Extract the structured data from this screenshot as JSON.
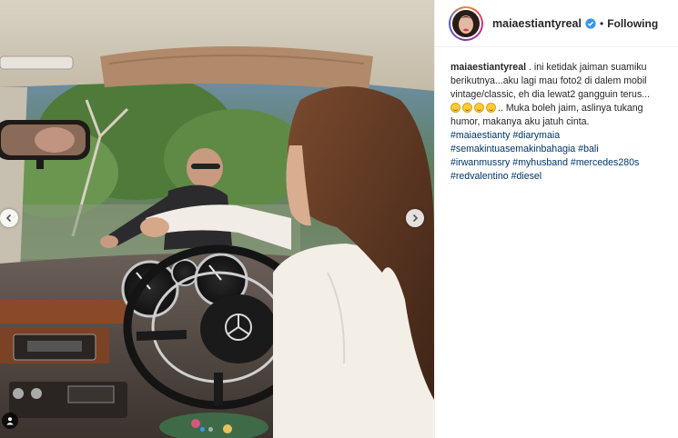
{
  "post": {
    "username": "maiaestiantyreal",
    "separator": "•",
    "follow_status": "Following",
    "caption": {
      "user": "maiaestiantyreal",
      "line1": " . ini ketidak jaiman suamiku",
      "line2": "berikutnya...aku lagi mau foto2 di dalem mobil",
      "line3": "vintage/classic, eh dia lewat2 gangguin terus...",
      "line4_after_emoji": ".. Muka boleh jaim, aslinya tukang",
      "line5": "humor, makanya aku jatuh cinta.",
      "emoji_count": 4
    },
    "hashtags": [
      [
        "#maiaestianty",
        "#diarymaia"
      ],
      [
        "#semakintuasemakinbahagia",
        "#bali"
      ],
      [
        "#irwanmussry",
        "#myhusband",
        "#mercedes280s"
      ],
      [
        "#redvalentino",
        "#diesel"
      ]
    ]
  },
  "icons": {
    "verified": "verified-badge-icon",
    "prev": "chevron-left-icon",
    "next": "chevron-right-icon",
    "tag": "user-tag-icon"
  },
  "colors": {
    "accent_blue": "#3897f0",
    "hashtag": "#003569",
    "text": "#262626"
  }
}
